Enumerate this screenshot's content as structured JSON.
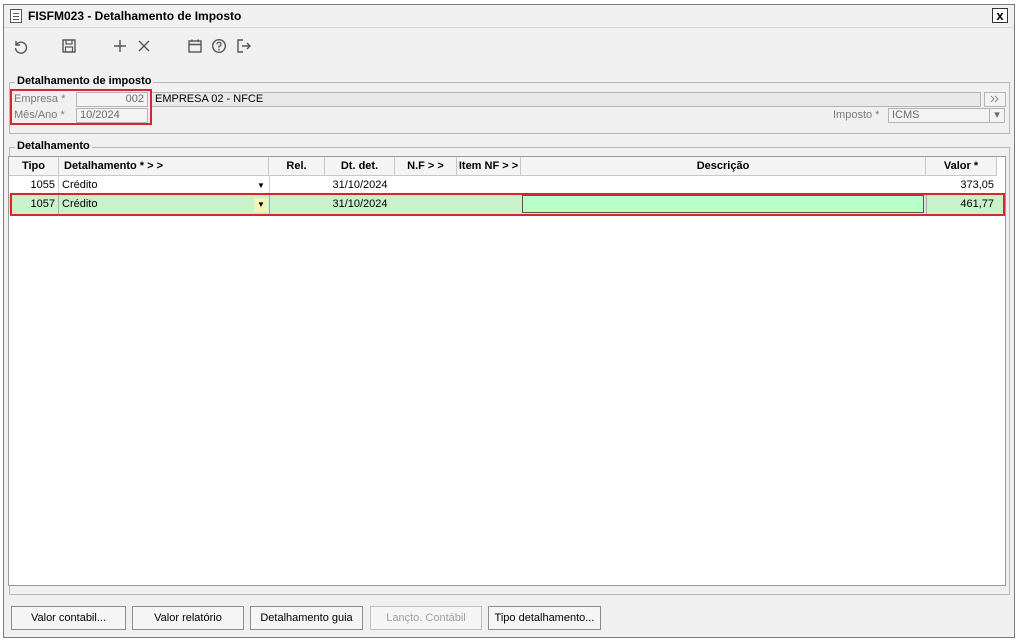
{
  "window": {
    "title": "FISFM023 - Detalhamento de Imposto",
    "close_label": "x"
  },
  "toolbar": {
    "icons": [
      "undo-icon",
      "save-icon",
      "add-icon",
      "delete-icon",
      "calendar-icon",
      "help-icon",
      "exit-icon"
    ]
  },
  "header_group": {
    "legend": "Detalhamento de imposto",
    "empresa_label": "Empresa *",
    "empresa_code": "002",
    "empresa_name": "EMPRESA 02 - NFCE",
    "mesano_label": "Mês/Ano *",
    "mesano_value": "10/2024",
    "imposto_label": "Imposto *",
    "imposto_value": "ICMS"
  },
  "detail_group": {
    "legend": "Detalhamento",
    "columns": [
      "Tipo",
      "Detalhamento *  > >",
      "Rel.",
      "Dt. det.",
      "N.F  > >",
      "Item NF > >",
      "Descrição",
      "Valor *"
    ],
    "rows": [
      {
        "tipo": "1055",
        "detalhamento": "Crédito",
        "rel": "",
        "dt_det": "31/10/2024",
        "nf": "",
        "item_nf": "",
        "descricao": "",
        "valor": "373,05"
      },
      {
        "tipo": "1057",
        "detalhamento": "Crédito",
        "rel": "",
        "dt_det": "31/10/2024",
        "nf": "",
        "item_nf": "",
        "descricao": "",
        "valor": "461,77"
      }
    ]
  },
  "buttons": {
    "valor_contabil": "Valor contabil...",
    "valor_relatorio": "Valor relatório",
    "detalhamento_guia": "Detalhamento guia",
    "lancto_contabil": "Lançto. Contábil",
    "tipo_detalhamento": "Tipo detalhamento..."
  },
  "colors": {
    "selected_row": "#c9f2c9",
    "highlight_border": "#d9262b"
  }
}
